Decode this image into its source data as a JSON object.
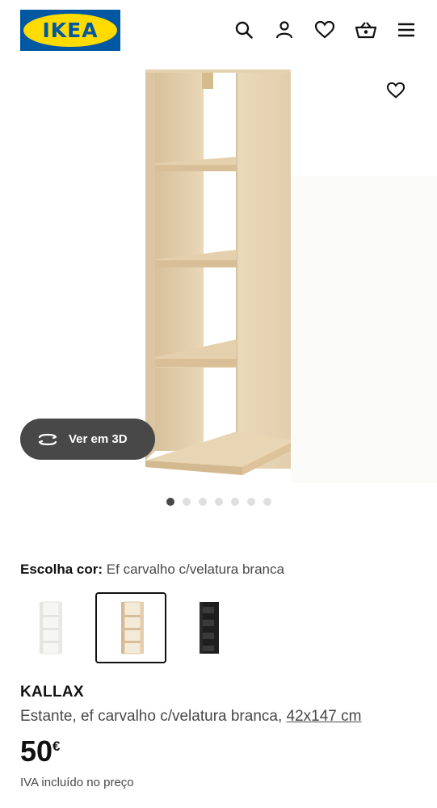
{
  "header": {
    "logo_text": "IKEA",
    "icons": [
      "search-icon",
      "account-icon",
      "favourites-icon",
      "cart-icon",
      "menu-icon"
    ]
  },
  "gallery": {
    "view_3d_label": "Ver em 3D",
    "image_count": 7,
    "active_index": 0
  },
  "colors": {
    "label": "Escolha cor:",
    "selected": "Ef carvalho c/velatura branca",
    "options": [
      "branco",
      "Ef carvalho c/velatura branca",
      "preto-castanho"
    ],
    "option_hex": [
      "#f4f4f2",
      "#e2cfae",
      "#2b2b2b"
    ],
    "selected_index": 1
  },
  "product": {
    "name": "KALLAX",
    "description": "Estante, ef carvalho c/velatura branca,",
    "measure": "42x147 cm",
    "price": "50",
    "currency": "€",
    "vat_note": "IVA incluído no preço"
  },
  "theme": {
    "brand_blue": "#0058a3",
    "brand_yellow": "#ffdb00",
    "wood": "#e6d3b3"
  }
}
